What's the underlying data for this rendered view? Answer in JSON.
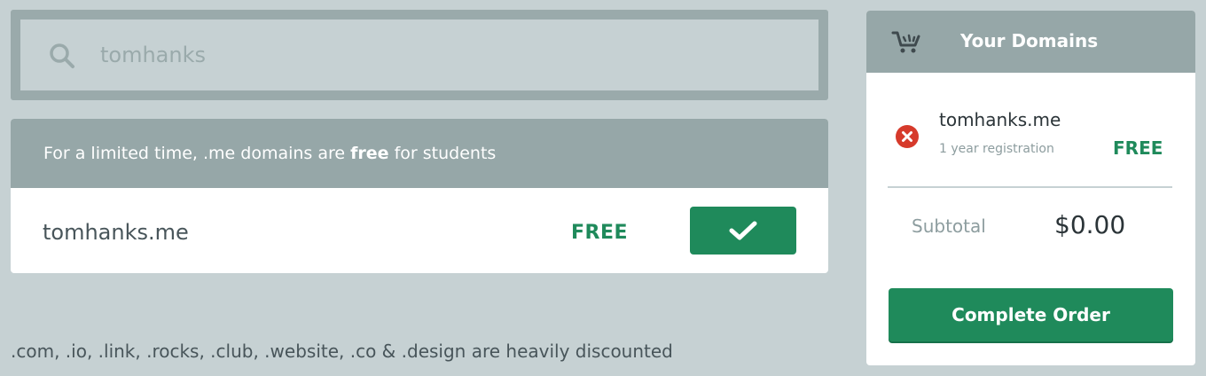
{
  "search": {
    "value": "tomhanks",
    "icon": "search-icon"
  },
  "promo": {
    "text_before": "For a limited time, .me domains are ",
    "text_bold": "free",
    "text_after": " for students",
    "domain": "tomhanks.me",
    "price": "FREE",
    "select_icon": "checkmark-icon"
  },
  "footer_note": ".com, .io, .link, .rocks, .club, .website, .co & .design are heavily discounted",
  "cart": {
    "title": "Your Domains",
    "icon": "cart-icon",
    "items": [
      {
        "name": "tomhanks.me",
        "term": "1 year registration",
        "price": "FREE",
        "remove_icon": "remove-icon"
      }
    ],
    "subtotal_label": "Subtotal",
    "subtotal_value": "$0.00",
    "complete_label": "Complete Order"
  },
  "colors": {
    "accent_green": "#1f8a5b",
    "header_gray": "#96a7a8",
    "background": "#c6d1d3",
    "remove_red": "#d63a2b"
  }
}
